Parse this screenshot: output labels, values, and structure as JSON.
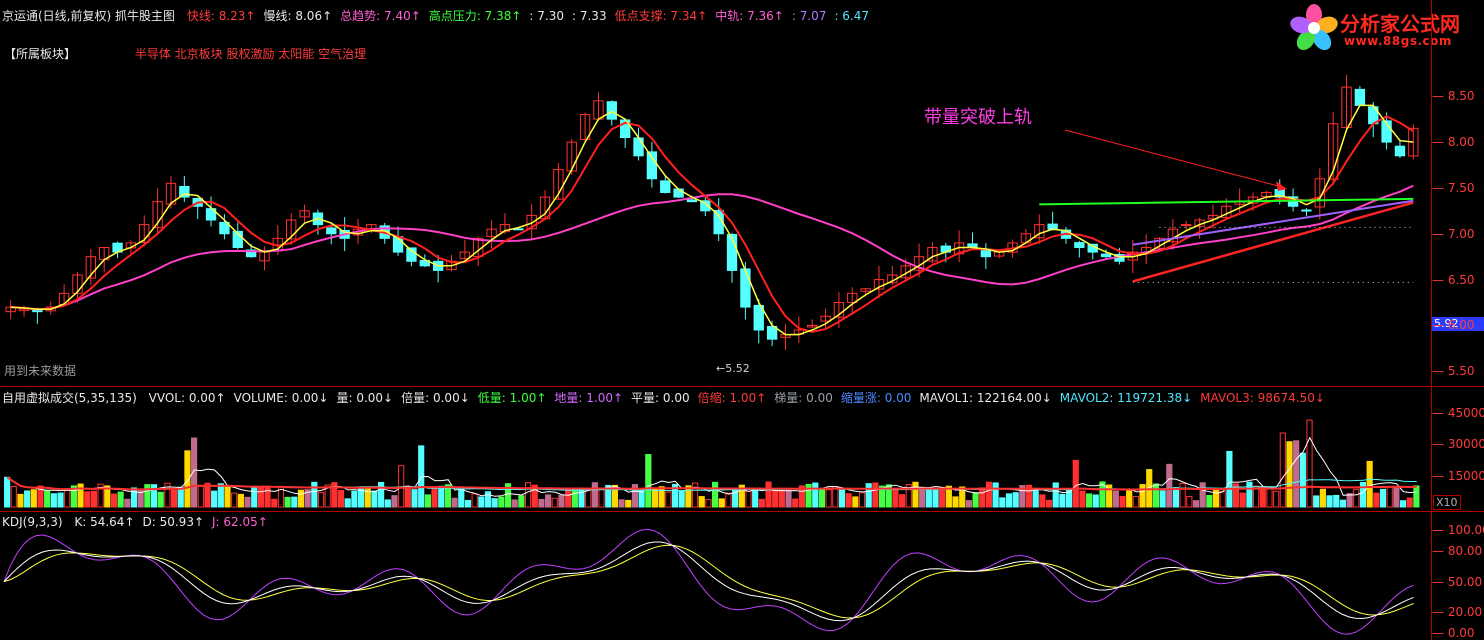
{
  "app": {
    "title": "京运通(日线,前复权)",
    "indicator_main": "抓牛股主图"
  },
  "main_header": [
    {
      "label": "快线:",
      "value": "8.23",
      "arrow": "↑",
      "color": "red"
    },
    {
      "label": "慢线:",
      "value": "8.06",
      "arrow": "↑",
      "color": "white"
    },
    {
      "label": "总趋势:",
      "value": "7.40",
      "arrow": "↑",
      "color": "pink"
    },
    {
      "label": "高点压力:",
      "value": "7.38",
      "arrow": "↑",
      "color": "green"
    },
    {
      "label": ":",
      "value": "7.30",
      "arrow": "",
      "color": "white"
    },
    {
      "label": ":",
      "value": "7.33",
      "arrow": "",
      "color": "white"
    },
    {
      "label": "低点支撑:",
      "value": "7.34",
      "arrow": "↑",
      "color": "red"
    },
    {
      "label": "中轨:",
      "value": "7.36",
      "arrow": "↑",
      "color": "pink"
    },
    {
      "label": ":",
      "value": "7.07",
      "arrow": "",
      "color": "lilac"
    },
    {
      "label": ":",
      "value": "6.47",
      "arrow": "",
      "color": "cyan"
    }
  ],
  "sector": {
    "label": "【所属板块】",
    "tags": "半导体  北京板块  股权激励 太阳能 空气治理"
  },
  "annotation": "带量突破上轨",
  "future_data_note": "用到未来数据",
  "low_price_label": "←5.52",
  "current_price_badge": "5.92",
  "logo": {
    "title": "分析家公式网",
    "url": "www.88gs.com"
  },
  "volume_header": [
    {
      "label": "自用虚拟成交(5,35,135)",
      "value": "",
      "arrow": "",
      "color": "white"
    },
    {
      "label": "VVOL:",
      "value": "0.00",
      "arrow": "↑",
      "color": "white"
    },
    {
      "label": "VOLUME:",
      "value": "0.00",
      "arrow": "↓",
      "color": "white"
    },
    {
      "label": "量:",
      "value": "0.00",
      "arrow": "↓",
      "color": "white"
    },
    {
      "label": "倍量:",
      "value": "0.00",
      "arrow": "↓",
      "color": "white"
    },
    {
      "label": "低量:",
      "value": "1.00",
      "arrow": "↑",
      "color": "green"
    },
    {
      "label": "地量:",
      "value": "1.00",
      "arrow": "↑",
      "color": "purple"
    },
    {
      "label": "平量:",
      "value": "0.00",
      "arrow": "",
      "color": "white"
    },
    {
      "label": "倍缩:",
      "value": "1.00",
      "arrow": "↑",
      "color": "red"
    },
    {
      "label": "梯量:",
      "value": "0.00",
      "arrow": "",
      "color": "gray"
    },
    {
      "label": "缩量涨:",
      "value": "0.00",
      "arrow": "",
      "color": "blue"
    },
    {
      "label": "MAVOL1:",
      "value": "122164.00",
      "arrow": "↓",
      "color": "white"
    },
    {
      "label": "MAVOL2:",
      "value": "119721.38",
      "arrow": "↓",
      "color": "cyan"
    },
    {
      "label": "MAVOL3:",
      "value": "98674.50",
      "arrow": "↓",
      "color": "red"
    }
  ],
  "kdj_header": [
    {
      "label": "KDJ(9,3,3)",
      "value": "",
      "arrow": "",
      "color": "white"
    },
    {
      "label": "K:",
      "value": "54.64",
      "arrow": "↑",
      "color": "white"
    },
    {
      "label": "D:",
      "value": "50.93",
      "arrow": "↑",
      "color": "white"
    },
    {
      "label": "J:",
      "value": "62.05",
      "arrow": "↑",
      "color": "pink"
    }
  ],
  "bei_marker": "倍",
  "x10_label": "X10",
  "colors": {
    "up": "#ff3030",
    "down": "#54ffff",
    "fast_line": "#ff2020",
    "slow_line": "#ffff40",
    "trend_line": "#ff40c8",
    "resistance": "#22ff22",
    "support_line": "#ff2424",
    "mid_track": "#a060ff",
    "axis": "#b00000"
  },
  "chart_data": [
    {
      "type": "candlestick",
      "title": "京运通(日线,前复权) 抓牛股主图",
      "ylabel": "",
      "yticks": [
        "8.50",
        "8.00",
        "7.50",
        "7.00",
        "6.50",
        "6.00",
        "5.50"
      ],
      "ylim": [
        5.35,
        8.95
      ],
      "low_annotation": 5.52,
      "close_series": [
        6.2,
        6.18,
        6.15,
        6.2,
        6.35,
        6.55,
        6.75,
        6.85,
        6.8,
        6.9,
        7.1,
        7.35,
        7.55,
        7.4,
        7.3,
        7.15,
        7.0,
        6.85,
        6.75,
        6.8,
        6.95,
        7.15,
        7.25,
        7.1,
        7.0,
        6.95,
        7.05,
        7.1,
        6.95,
        6.8,
        6.7,
        6.65,
        6.6,
        6.7,
        6.8,
        6.95,
        7.05,
        7.1,
        7.05,
        7.2,
        7.4,
        7.7,
        8.0,
        8.3,
        8.45,
        8.25,
        8.05,
        7.85,
        7.6,
        7.45,
        7.4,
        7.35,
        7.25,
        7.0,
        6.6,
        6.2,
        5.95,
        5.85,
        5.9,
        5.95,
        6.0,
        6.1,
        6.25,
        6.35,
        6.4,
        6.5,
        6.55,
        6.65,
        6.75,
        6.85,
        6.8,
        6.9,
        6.85,
        6.75,
        6.8,
        6.9,
        7.0,
        7.1,
        7.05,
        6.95,
        6.85,
        6.8,
        6.75,
        6.7,
        6.8,
        6.85,
        6.95,
        7.05,
        7.1,
        7.15,
        7.2,
        7.3,
        7.35,
        7.4,
        7.45,
        7.4,
        7.3,
        7.25,
        7.6,
        8.2,
        8.6,
        8.4,
        8.2,
        8.0,
        7.85,
        8.15
      ]
    },
    {
      "type": "bar",
      "title": "自用虚拟成交(5,35,135)",
      "yticks": [
        "45000",
        "30000",
        "15000"
      ],
      "ylim": [
        0,
        55000
      ],
      "multiplier_label": "X10",
      "mavol_lines": [
        "MAVOL1",
        "MAVOL2",
        "MAVOL3"
      ]
    },
    {
      "type": "line",
      "title": "KDJ(9,3,3)",
      "yticks": [
        "100.00",
        "80.00",
        "50.00",
        "20.00",
        "0.00"
      ],
      "ylim": [
        -5,
        110
      ],
      "series": [
        {
          "name": "K"
        },
        {
          "name": "D"
        },
        {
          "name": "J"
        }
      ]
    }
  ]
}
